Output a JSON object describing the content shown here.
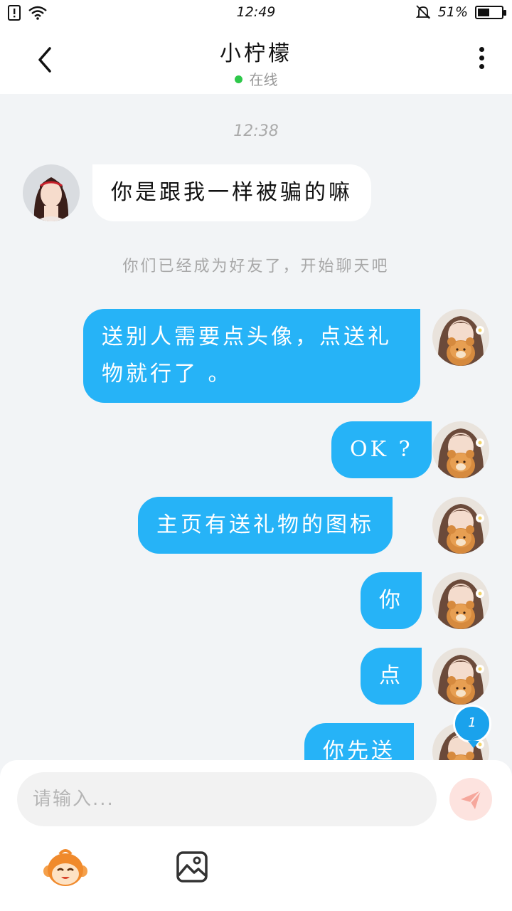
{
  "status_bar": {
    "time": "12:49",
    "battery_text": "51%",
    "battery_level_percent": 51,
    "icons": [
      "sim-alert-icon",
      "wifi-icon",
      "mute-bell-icon",
      "battery-icon"
    ]
  },
  "header": {
    "title": "小柠檬",
    "presence": "在线",
    "presence_color": "#2ec84a",
    "back_icon": "chevron-left-icon",
    "more_icon": "more-vertical-icon"
  },
  "chat": {
    "timestamp": "12:38",
    "system_message": "你们已经成为好友了，开始聊天吧",
    "incoming_bubble_color": "#ffffff",
    "outgoing_bubble_color": "#26b3f7",
    "messages": [
      {
        "direction": "in",
        "text": "你是跟我一样被骗的嘛"
      },
      {
        "direction": "out",
        "text": "送别人需要点头像，点送礼物就行了 。"
      },
      {
        "direction": "out",
        "text": "OK ?"
      },
      {
        "direction": "out",
        "text": "主页有送礼物的图标"
      },
      {
        "direction": "out",
        "text": "你"
      },
      {
        "direction": "out",
        "text": "点"
      },
      {
        "direction": "out",
        "text": "你先送"
      }
    ],
    "unread_badge": "1"
  },
  "input_bar": {
    "placeholder": "请输入...",
    "send_icon": "paper-plane-icon",
    "emoji_icon": "monkey-emoji-icon",
    "image_icon": "image-icon"
  }
}
